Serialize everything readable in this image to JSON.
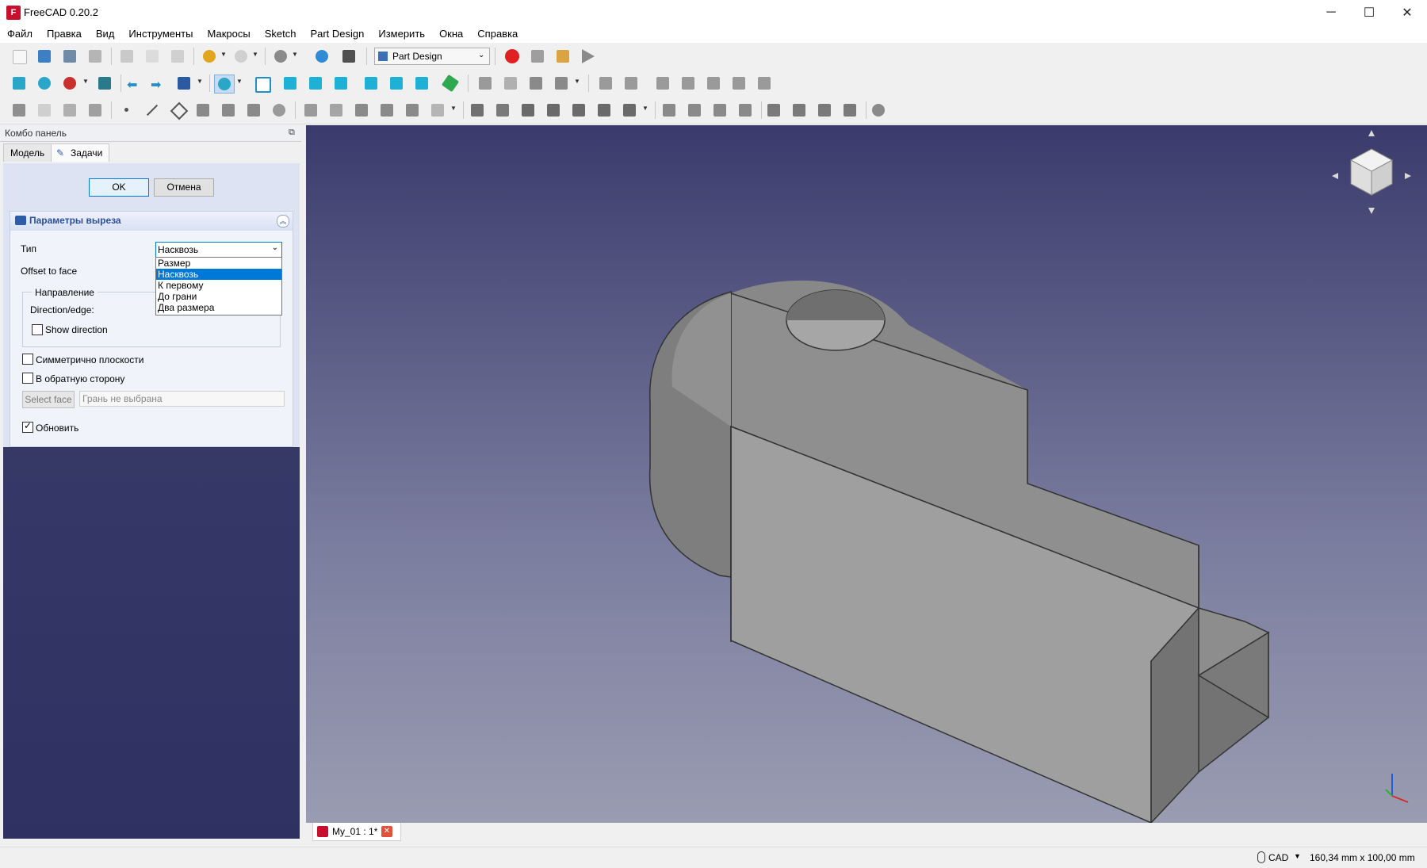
{
  "window": {
    "title": "FreeCAD 0.20.2",
    "controls": [
      "─",
      "☐",
      "✕"
    ]
  },
  "menu": [
    "Файл",
    "Правка",
    "Вид",
    "Инструменты",
    "Макросы",
    "Sketch",
    "Part Design",
    "Измерить",
    "Окна",
    "Справка"
  ],
  "toolbar": {
    "workbench": "Part Design"
  },
  "combo": {
    "title": "Комбо панель",
    "tabs": [
      "Модель",
      "Задачи"
    ],
    "ok": "OK",
    "cancel": "Отмена",
    "section_title": "Параметры выреза",
    "type_label": "Тип",
    "type_value": "Насквозь",
    "type_options": [
      "Размер",
      "Насквозь",
      "К первому",
      "До грани",
      "Два размера"
    ],
    "offset_label": "Offset to face",
    "direction_group": "Направление",
    "direction_edge": "Direction/edge:",
    "show_direction": "Show direction",
    "symmetric": "Симметрично плоскости",
    "reversed": "В обратную сторону",
    "select_face": "Select face",
    "face_placeholder": "Грань не выбрана",
    "refresh": "Обновить",
    "checks": {
      "show_direction": false,
      "symmetric": false,
      "reversed": false,
      "refresh": true
    }
  },
  "document": {
    "tab_label": "My_01 : 1*"
  },
  "status": {
    "nav_style": "CAD",
    "dimensions": "160,34 mm x 100,00 mm"
  },
  "colors": {
    "accent": "#0078d7",
    "record": "#e02020",
    "viewport_top": "#3a3b6c",
    "viewport_bottom": "#9a9cb2",
    "part": "#9b9b9b"
  }
}
